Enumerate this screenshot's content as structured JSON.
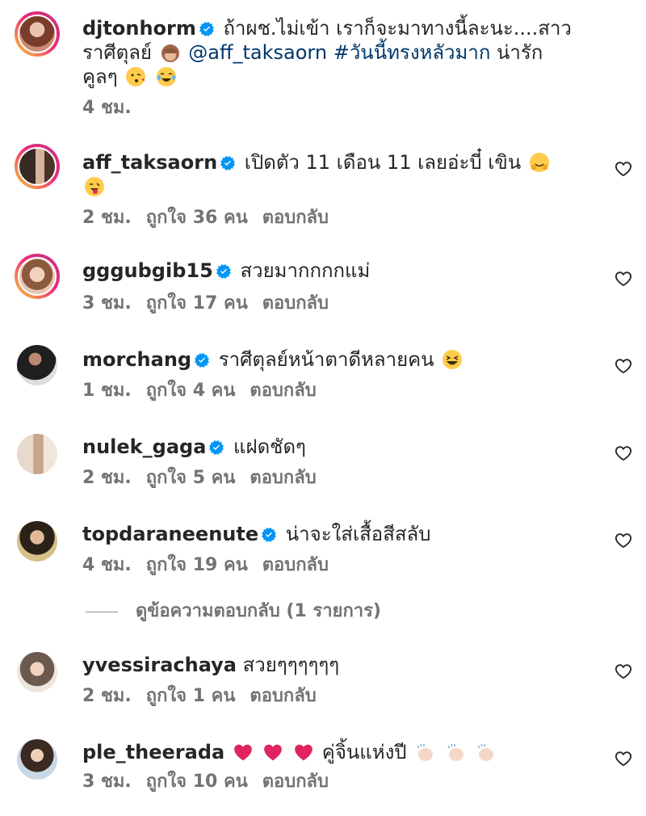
{
  "caption": {
    "username": "djtonhorm",
    "text_line1": "ถ้าผช.ไม่เข้า เราก็จะมาทางนี้ละนะ....สาว",
    "text_line2_prefix": "ราศีตุลย์",
    "mention": "@aff_taksaorn",
    "hashtag": "#วันนี้ทรงหลัวมาก",
    "text_line2_suffix": "น่ารัก",
    "text_line3": "คูลๆ",
    "time": "4 ชม."
  },
  "comments": [
    {
      "username": "aff_taksaorn",
      "text": "เปิดตัว 11 เดือน 11 เลยอ่ะบี๋ เขิน",
      "time": "2 ชม.",
      "likes": "ถูกใจ 36 คน",
      "reply": "ตอบกลับ"
    },
    {
      "username": "gggubgib15",
      "text": "สวยมากกกกแม่",
      "time": "3 ชม.",
      "likes": "ถูกใจ 17 คน",
      "reply": "ตอบกลับ"
    },
    {
      "username": "morchang",
      "text": "ราศีตุลย์หน้าตาดีหลายคน",
      "time": "1 ชม.",
      "likes": "ถูกใจ 4 คน",
      "reply": "ตอบกลับ"
    },
    {
      "username": "nulek_gaga",
      "text": "แฝดชัดๆ",
      "time": "2 ชม.",
      "likes": "ถูกใจ 5 คน",
      "reply": "ตอบกลับ"
    },
    {
      "username": "topdaraneenute",
      "text": "น่าจะใส่เสื้อสีสลับ",
      "time": "4 ชม.",
      "likes": "ถูกใจ 19 คน",
      "reply": "ตอบกลับ"
    },
    {
      "username": "yvessirachaya",
      "text": "สวยๆๆๆๆๆๆ",
      "time": "2 ชม.",
      "likes": "ถูกใจ 1 คน",
      "reply": "ตอบกลับ"
    },
    {
      "username": "ple_theerada",
      "text": "คู่จิ้นแห่งปี",
      "time": "3 ชม.",
      "likes": "ถูกใจ 10 คน",
      "reply": "ตอบกลับ"
    }
  ],
  "view_replies": "ดูข้อความตอบกลับ (1 รายการ)",
  "colors": {
    "text": "#262626",
    "meta": "#737373",
    "link": "#00376b",
    "verified": "#0095f6",
    "heart_red": "#e0245e"
  },
  "icons": [
    "verified-badge-icon",
    "heart-outline-icon",
    "emoji-icon",
    "red-heart-icon",
    "clapping-hands-icon"
  ]
}
